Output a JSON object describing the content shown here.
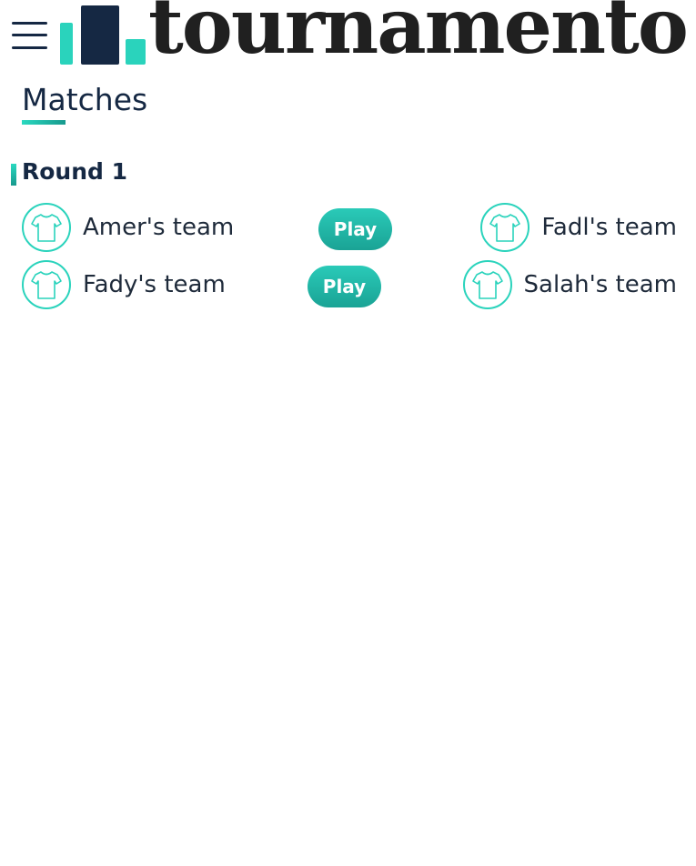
{
  "header": {
    "menu_icon": "hamburger-menu-icon",
    "logo_text": "tournamento",
    "logo_colors": {
      "bar_dark": "#152843",
      "bar_light": "#2ad3bc"
    }
  },
  "page": {
    "title": "Matches"
  },
  "rounds": [
    {
      "title": "Round 1",
      "matches": [
        {
          "home": "Amer's team",
          "action": "Play",
          "away": "Fadl's team"
        },
        {
          "home": "Fady's team",
          "action": "Play",
          "away": "Salah's team"
        }
      ]
    }
  ],
  "icons": {
    "team": "tshirt-icon"
  },
  "colors": {
    "accent": "#2ad3bc",
    "primary": "#152843",
    "button": "#1fb5a5"
  }
}
